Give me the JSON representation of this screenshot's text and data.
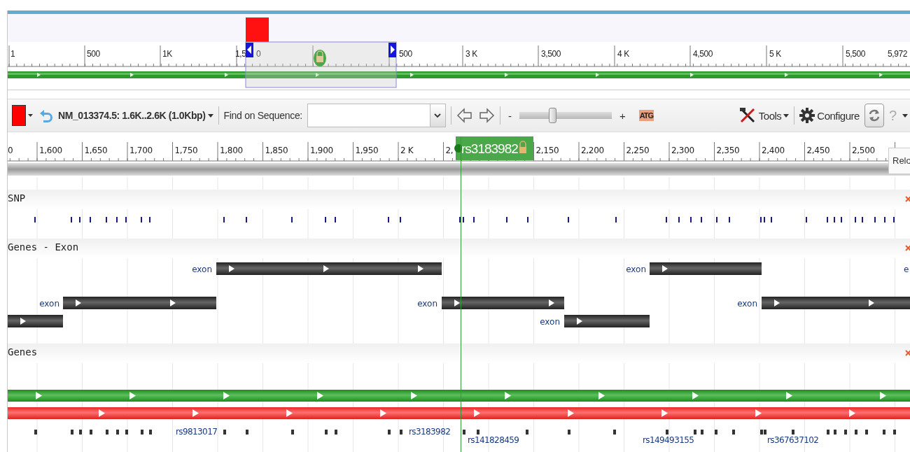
{
  "overview": {
    "ruler_labels": [
      "1",
      "500",
      "1K",
      "1,5",
      "0",
      "500",
      "3 K",
      "3,500",
      "4 K",
      "4,500",
      "5 K",
      "5,500",
      "5,972"
    ]
  },
  "toolbar": {
    "sequence_label": "NM_013374.5: 1.6K..2.6K (1.0Kbp)",
    "find_label": "Find on Sequence:",
    "zoom_out": "-",
    "zoom_in": "+",
    "zoom": {
      "level": 0.36
    },
    "sequence_icon": "ATG",
    "tools": "Tools",
    "configure": "Configure",
    "help": "?"
  },
  "ruler": {
    "labels": [
      "0",
      "1,600",
      "1,650",
      "1,700",
      "1,750",
      "1,800",
      "1,850",
      "1,900",
      "1,950",
      "2 K",
      "2,",
      "2,150",
      "2,200",
      "2,250",
      "2,300",
      "2,350",
      "2,400",
      "2,450",
      "2,500"
    ]
  },
  "marker": {
    "label": "rs3183982"
  },
  "tooltip": "Relo",
  "tracks": [
    {
      "kind": "snp",
      "title": "SNP"
    },
    {
      "kind": "exons",
      "title": "Genes - Exon",
      "features": [
        {
          "kind": "labeled_bar",
          "label": "exon"
        },
        {
          "kind": "labeled_bar",
          "label": "exon"
        },
        {
          "kind": "label_only",
          "label": "e"
        },
        {
          "kind": "labeled_bar",
          "label": "exon"
        },
        {
          "kind": "labeled_bar",
          "label": "exon"
        },
        {
          "kind": "labeled_bar",
          "label": "exon"
        },
        {
          "kind": "bar_only"
        },
        {
          "kind": "labeled_bar",
          "label": "exon"
        }
      ]
    },
    {
      "kind": "genes",
      "title": "Genes",
      "snp_labels": [
        "rs9813017",
        "rs3183982",
        "rs141828459",
        "rs149493155",
        "rs367637102"
      ]
    }
  ]
}
